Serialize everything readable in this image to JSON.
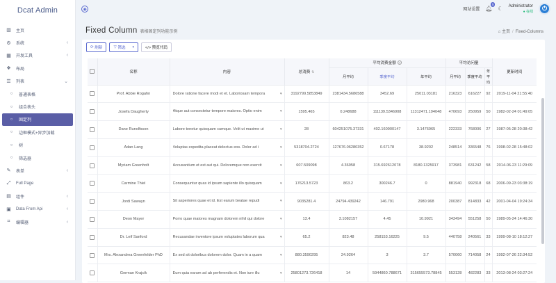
{
  "app": {
    "brand": "Dcat Admin"
  },
  "sidebar": {
    "items": [
      {
        "icon": "bar-chart-icon",
        "glyph": "▥",
        "label": "主页",
        "arrow": "",
        "sub": false,
        "active": false
      },
      {
        "icon": "gear-icon",
        "glyph": "⚙",
        "label": "系统",
        "arrow": "‹",
        "sub": false,
        "active": false
      },
      {
        "icon": "grid-icon",
        "glyph": "▦",
        "label": "开发工具",
        "arrow": "‹",
        "sub": false,
        "active": false
      },
      {
        "icon": "layout-icon",
        "glyph": "❖",
        "label": "布局",
        "arrow": "",
        "sub": false,
        "active": false
      },
      {
        "icon": "list-icon",
        "glyph": "☰",
        "label": "列表",
        "arrow": "⌄",
        "sub": false,
        "active": false
      },
      {
        "icon": "circle-icon",
        "glyph": "○",
        "label": "普通表格",
        "arrow": "",
        "sub": true,
        "active": false
      },
      {
        "icon": "circle-icon",
        "glyph": "○",
        "label": "组合表头",
        "arrow": "",
        "sub": true,
        "active": false
      },
      {
        "icon": "circle-icon",
        "glyph": "○",
        "label": "固定列",
        "arrow": "",
        "sub": true,
        "active": true
      },
      {
        "icon": "circle-icon",
        "glyph": "○",
        "label": "边框模式+异步加载",
        "arrow": "",
        "sub": true,
        "active": false
      },
      {
        "icon": "circle-icon",
        "glyph": "○",
        "label": "树",
        "arrow": "",
        "sub": true,
        "active": false
      },
      {
        "icon": "circle-icon",
        "glyph": "○",
        "label": "筛选器",
        "arrow": "",
        "sub": true,
        "active": false
      },
      {
        "icon": "edit-icon",
        "glyph": "✎",
        "label": "表单",
        "arrow": "‹",
        "sub": false,
        "active": false
      },
      {
        "icon": "expand-icon",
        "glyph": "⤢",
        "label": "Full Page",
        "arrow": "",
        "sub": false,
        "active": false
      },
      {
        "icon": "puzzle-icon",
        "glyph": "▤",
        "label": "组件",
        "arrow": "‹",
        "sub": false,
        "active": false
      },
      {
        "icon": "database-icon",
        "glyph": "▣",
        "label": "Data From Api",
        "arrow": "‹",
        "sub": false,
        "active": false
      },
      {
        "icon": "code-icon",
        "glyph": "⌗",
        "label": "编辑器",
        "arrow": "‹",
        "sub": false,
        "active": false
      }
    ]
  },
  "header": {
    "settings_label": "网站设置",
    "notifications_count": "5",
    "user_name": "Administrator",
    "user_status": "● 在线"
  },
  "page": {
    "title": "Fixed Column",
    "description": "表格固定列功能示例",
    "breadcrumb_home": "主页",
    "breadcrumb_current": "Fixed-Columns"
  },
  "toolbar": {
    "refresh_label": "刷新",
    "filter_label": "筛选",
    "preview_label": "</> 预览代码"
  },
  "table": {
    "headers": {
      "name": "名称",
      "content": "内容",
      "total": "总消费",
      "avg_group": "平均消费金额",
      "avg_visit": "平均访问量",
      "update_time": "更新时间",
      "month_avg": "月平均",
      "quarter_avg": "季度平均",
      "year_avg": "年平均"
    },
    "rows": [
      {
        "name": "Prof. Abbie Rogahn",
        "content": "Dolore ratione facere modi et et. Laboriosam tempora",
        "total": "3192799.5853849",
        "m": "2381434.5686588",
        "q": "3452.69",
        "y": "25011.03181",
        "vm": "216323",
        "vq": "616227",
        "vy": "92",
        "time": "2019-11-04 21:55:40"
      },
      {
        "name": "Josefa Daugherty",
        "content": "Atque aut consectetur tempore maiores. Optio enim",
        "total": "1595.465",
        "m": "0.248688",
        "q": "111139.5346908",
        "y": "11312471.194048",
        "vm": "470693",
        "vq": "250959",
        "vy": "50",
        "time": "1982-02-24 01:49:05"
      },
      {
        "name": "Dane Runolfsson",
        "content": "Labore tenetur quisquam cumque. Velit ut maxime ut",
        "total": "28",
        "m": "604251075.37331",
        "q": "402.160900147",
        "y": "3.1476965",
        "vm": "222333",
        "vq": "768006",
        "vy": "27",
        "time": "1987-05-28 20:38:42"
      },
      {
        "name": "Adan Lang",
        "content": "Voluptas expedita placeat delectus eos. Dolor ad i",
        "total": "5318704.2724",
        "m": "127676.06280352",
        "q": "0.67178",
        "y": "38.9202",
        "vm": "248514",
        "vq": "336548",
        "vy": "76",
        "time": "1998-02-28 15:48:02"
      },
      {
        "name": "Myriam Greenholt",
        "content": "Accusantium et est aut qui. Doloremque non exercit",
        "total": "607.509098",
        "m": "4.36958",
        "q": "315.692612078",
        "y": "8180.1325917",
        "vm": "373981",
        "vq": "631242",
        "vy": "58",
        "time": "2014-06-23 11:29:09"
      },
      {
        "name": "Carmine Thiel",
        "content": "Consequuntur quas id ipsum sapiente illo quisquam",
        "total": "176213.5723",
        "m": "863.2",
        "q": "300246.7",
        "y": "0",
        "vm": "881940",
        "vq": "992318",
        "vy": "68",
        "time": "2006-09-23 03:38:19"
      },
      {
        "name": "Jordi Sawayn",
        "content": "Sit asperiores quae et id. Est earum beatae repudi",
        "total": "9035281.4",
        "m": "24794.439242",
        "q": "146.791",
        "y": "2980.968",
        "vm": "200387",
        "vq": "814833",
        "vy": "42",
        "time": "2001-04-04 19:24:34"
      },
      {
        "name": "Deon Mayer",
        "content": "Porro quae maiores magnam dolorem nihil qui dolore",
        "total": "13.4",
        "m": "3.1082157",
        "q": "4.45",
        "y": "10.9921",
        "vm": "343494",
        "vq": "551258",
        "vy": "50",
        "time": "1989-05-24 14:46:30"
      },
      {
        "name": "Dr. Leif Sanford",
        "content": "Recusandae inventore ipsum voluptates laborum qua",
        "total": "65.2",
        "m": "823.48",
        "q": "258153.16225",
        "y": "9.5",
        "vm": "440758",
        "vq": "240561",
        "vy": "33",
        "time": "1999-08-10 18:12:27"
      },
      {
        "name": "Mrs. Alexandrea Greenfelder PhD",
        "content": "Ex sed sit doloribus dolorem dolor. Quam in a quam",
        "total": "880.3590295",
        "m": "24.9264",
        "q": "3",
        "y": "3.7",
        "vm": "570060",
        "vq": "714058",
        "vy": "24",
        "time": "1992-07-26 22:34:52"
      },
      {
        "name": "German Krajcik",
        "content": "Eum quia earum ad ab perferendis et. Non iure illu",
        "total": "25801273.726418",
        "m": "14",
        "q": "5944860.788671",
        "y": "315655573.78845",
        "vm": "553128",
        "vq": "482283",
        "vy": "33",
        "time": "2013-08-24 03:27:24"
      }
    ]
  }
}
